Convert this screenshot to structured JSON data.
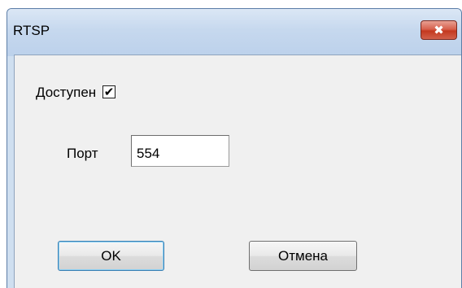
{
  "window": {
    "title": "RTSP",
    "close_glyph": "✖"
  },
  "form": {
    "enabled_label": "Доступен",
    "enabled_checked": true,
    "check_glyph": "✔",
    "port_label": "Порт",
    "port_value": "554"
  },
  "buttons": {
    "ok_label": "OK",
    "cancel_label": "Отмена"
  }
}
